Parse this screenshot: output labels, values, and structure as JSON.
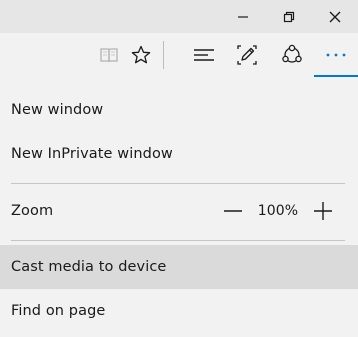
{
  "window_controls": {
    "minimize_icon": "minimize-icon",
    "maximize_icon": "restore-icon",
    "close_icon": "close-icon"
  },
  "toolbar": {
    "reading_view_icon": "book-icon",
    "favorites_icon": "star-icon",
    "hub_icon": "hub-icon",
    "web_note_icon": "pen-icon",
    "share_icon": "share-icon",
    "more_icon": "more-icon",
    "accent_color": "#0078d7"
  },
  "menu": {
    "new_window": "New window",
    "new_inprivate_window": "New InPrivate window",
    "zoom_label": "Zoom",
    "zoom_value": "100%",
    "cast_media": "Cast media to device",
    "find_on_page": "Find on page"
  }
}
